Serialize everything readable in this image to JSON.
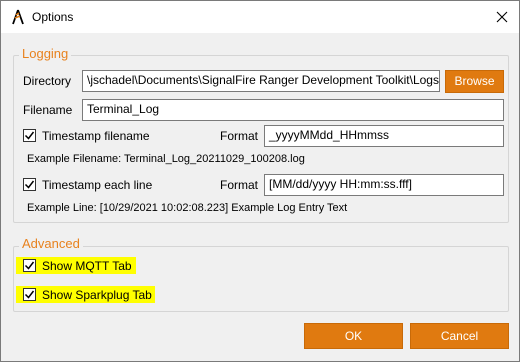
{
  "window": {
    "title": "Options",
    "icon": "signalfire-logo-icon",
    "close_icon": "close-icon"
  },
  "logging": {
    "title": "Logging",
    "directory_label": "Directory",
    "directory_value": "\\jschadel\\Documents\\SignalFire Ranger Development Toolkit\\Logs",
    "browse_label": "Browse",
    "filename_label": "Filename",
    "filename_value": "Terminal_Log",
    "timestamp_filename_label": "Timestamp filename",
    "timestamp_filename_checked": true,
    "format_label": "Format",
    "filename_format_value": "_yyyyMMdd_HHmmss",
    "example_filename": "Example Filename: Terminal_Log_20211029_100208.log",
    "timestamp_line_label": "Timestamp each line",
    "timestamp_line_checked": true,
    "line_format_label": "Format",
    "line_format_value": "[MM/dd/yyyy HH:mm:ss.fff]",
    "example_line": "Example Line: [10/29/2021 10:02:08.223] Example Log Entry Text"
  },
  "advanced": {
    "title": "Advanced",
    "mqtt_label": "Show MQTT Tab",
    "mqtt_checked": true,
    "sparkplug_label": "Show Sparkplug Tab",
    "sparkplug_checked": true
  },
  "footer": {
    "ok_label": "OK",
    "cancel_label": "Cancel"
  },
  "colors": {
    "accent": "#e07a10",
    "group_title": "#e8821e",
    "highlight": "#ffff00"
  }
}
